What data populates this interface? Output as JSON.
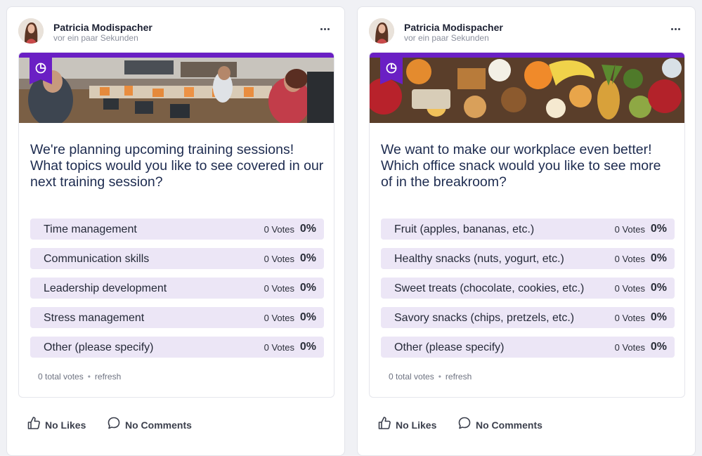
{
  "posts": [
    {
      "author": "Patricia Modispacher",
      "timestamp": "vor ein paar Sekunden",
      "poll": {
        "question": "We're planning upcoming training sessions! What topics would you like to see covered in our next training session?",
        "options": [
          {
            "label": "Time management",
            "votes": "0 Votes",
            "percent": "0%"
          },
          {
            "label": "Communication skills",
            "votes": "0 Votes",
            "percent": "0%"
          },
          {
            "label": "Leadership development",
            "votes": "0 Votes",
            "percent": "0%"
          },
          {
            "label": "Stress management",
            "votes": "0 Votes",
            "percent": "0%"
          },
          {
            "label": "Other (please specify)",
            "votes": "0 Votes",
            "percent": "0%"
          }
        ],
        "total_votes": "0 total votes",
        "refresh": "refresh"
      },
      "likes": "No Likes",
      "comments": "No Comments"
    },
    {
      "author": "Patricia Modispacher",
      "timestamp": "vor ein paar Sekunden",
      "poll": {
        "question": "We want to make our workplace even better! Which office snack would you like to see more of in the breakroom?",
        "options": [
          {
            "label": "Fruit (apples, bananas, etc.)",
            "votes": "0 Votes",
            "percent": "0%"
          },
          {
            "label": "Healthy snacks (nuts, yogurt, etc.)",
            "votes": "0 Votes",
            "percent": "0%"
          },
          {
            "label": "Sweet treats (chocolate, cookies, etc.)",
            "votes": "0 Votes",
            "percent": "0%"
          },
          {
            "label": "Savory snacks (chips, pretzels, etc.)",
            "votes": "0 Votes",
            "percent": "0%"
          },
          {
            "label": "Other (please specify)",
            "votes": "0 Votes",
            "percent": "0%"
          }
        ],
        "total_votes": "0 total votes",
        "refresh": "refresh"
      },
      "likes": "No Likes",
      "comments": "No Comments"
    }
  ],
  "icons": {
    "more": "more-horizontal-icon",
    "poll": "poll-chart-icon",
    "like": "thumbs-up-icon",
    "comment": "comment-bubble-icon"
  },
  "colors": {
    "accent": "#6a1fc4",
    "option_bg": "#ece6f6",
    "question_text": "#1d2b4f"
  }
}
